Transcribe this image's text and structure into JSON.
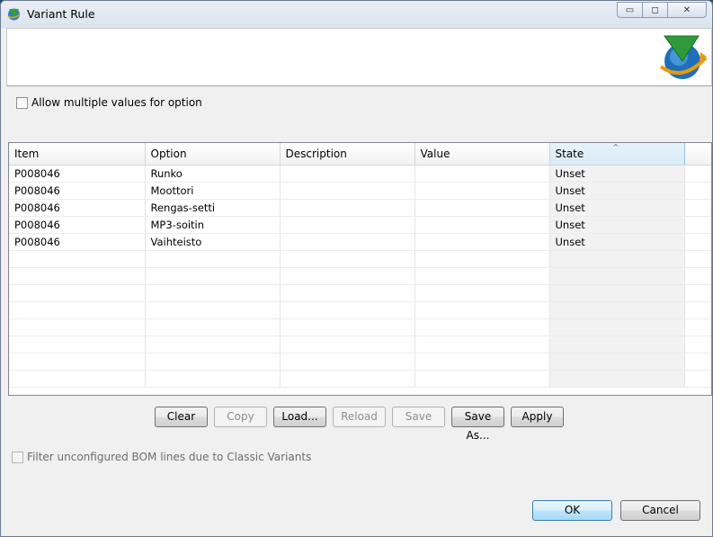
{
  "window": {
    "title": "Variant Rule",
    "minimize_glyph": "▭",
    "maximize_glyph": "◻",
    "close_glyph": "✕"
  },
  "options": {
    "allow_multiple_label": "Allow multiple values for option",
    "allow_multiple_checked": false,
    "filter_label": "Filter unconfigured BOM lines due to Classic Variants",
    "filter_checked": false
  },
  "table": {
    "columns": [
      "Item",
      "Option",
      "Description",
      "Value",
      "State"
    ],
    "sort_glyph": "^",
    "rows": [
      [
        "P008046",
        "Runko",
        "",
        "",
        "Unset"
      ],
      [
        "P008046",
        "Moottori",
        "",
        "",
        "Unset"
      ],
      [
        "P008046",
        "Rengas-setti",
        "",
        "",
        "Unset"
      ],
      [
        "P008046",
        "MP3-soitin",
        "",
        "",
        "Unset"
      ],
      [
        "P008046",
        "Vaihteisto",
        "",
        "",
        "Unset"
      ]
    ]
  },
  "actions": {
    "clear": "Clear",
    "copy": "Copy",
    "load": "Load...",
    "reload": "Reload",
    "save": "Save",
    "save_as": "Save As...",
    "apply": "Apply"
  },
  "dialog": {
    "ok": "OK",
    "cancel": "Cancel"
  },
  "colors": {
    "sorted_column": "#d7ebf7",
    "default_button_border": "#3c7fb1"
  }
}
